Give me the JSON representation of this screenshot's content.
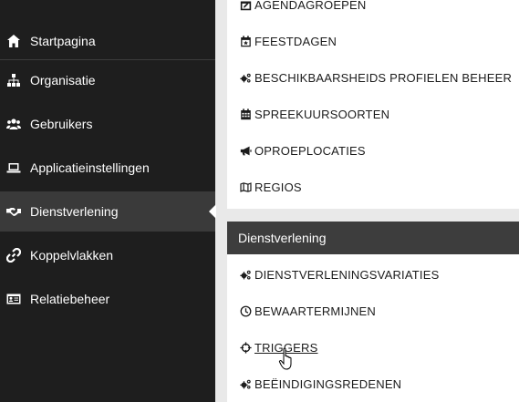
{
  "sidebar": {
    "items": [
      {
        "label": "Startpagina",
        "icon": "home-icon"
      },
      {
        "label": "Organisatie",
        "icon": "sitemap-icon"
      },
      {
        "label": "Gebruikers",
        "icon": "users-icon"
      },
      {
        "label": "Applicatieinstellingen",
        "icon": "laptop-icon"
      },
      {
        "label": "Dienstverlening",
        "icon": "handshake-icon",
        "active": true
      },
      {
        "label": "Koppelvlakken",
        "icon": "link-icon"
      },
      {
        "label": "Relatiebeheer",
        "icon": "id-card-icon"
      }
    ]
  },
  "top_section": {
    "items": [
      {
        "label": "AGENDAGROEPEN",
        "icon": "calendar-edit-icon"
      },
      {
        "label": "FEESTDAGEN",
        "icon": "calendar-star-icon"
      },
      {
        "label": "BESCHIKBAARSHEIDS PROFIELEN BEHEER",
        "icon": "cogs-icon"
      },
      {
        "label": "SPREEKUURSOORTEN",
        "icon": "calendar-grid-icon"
      },
      {
        "label": "OPROEPLOCATIES",
        "icon": "bullhorn-icon"
      },
      {
        "label": "REGIOS",
        "icon": "map-icon"
      }
    ]
  },
  "dienstverlening_section": {
    "title": "Dienstverlening",
    "items": [
      {
        "label": "DIENSTVERLENINGSVARIATIES",
        "icon": "cogs-icon"
      },
      {
        "label": "BEWAARTERMIJNEN",
        "icon": "clock-icon"
      },
      {
        "label": "TRIGGERS",
        "icon": "crosshairs-icon",
        "hover": true
      },
      {
        "label": "BEËINDIGINGSREDENEN",
        "icon": "cogs-icon"
      }
    ]
  },
  "colors": {
    "sidebar_bg": "#1e1e1e",
    "sidebar_active": "#3a3a3a",
    "header_bg": "#3d3d3d",
    "page_bg": "#e9e9e9"
  }
}
